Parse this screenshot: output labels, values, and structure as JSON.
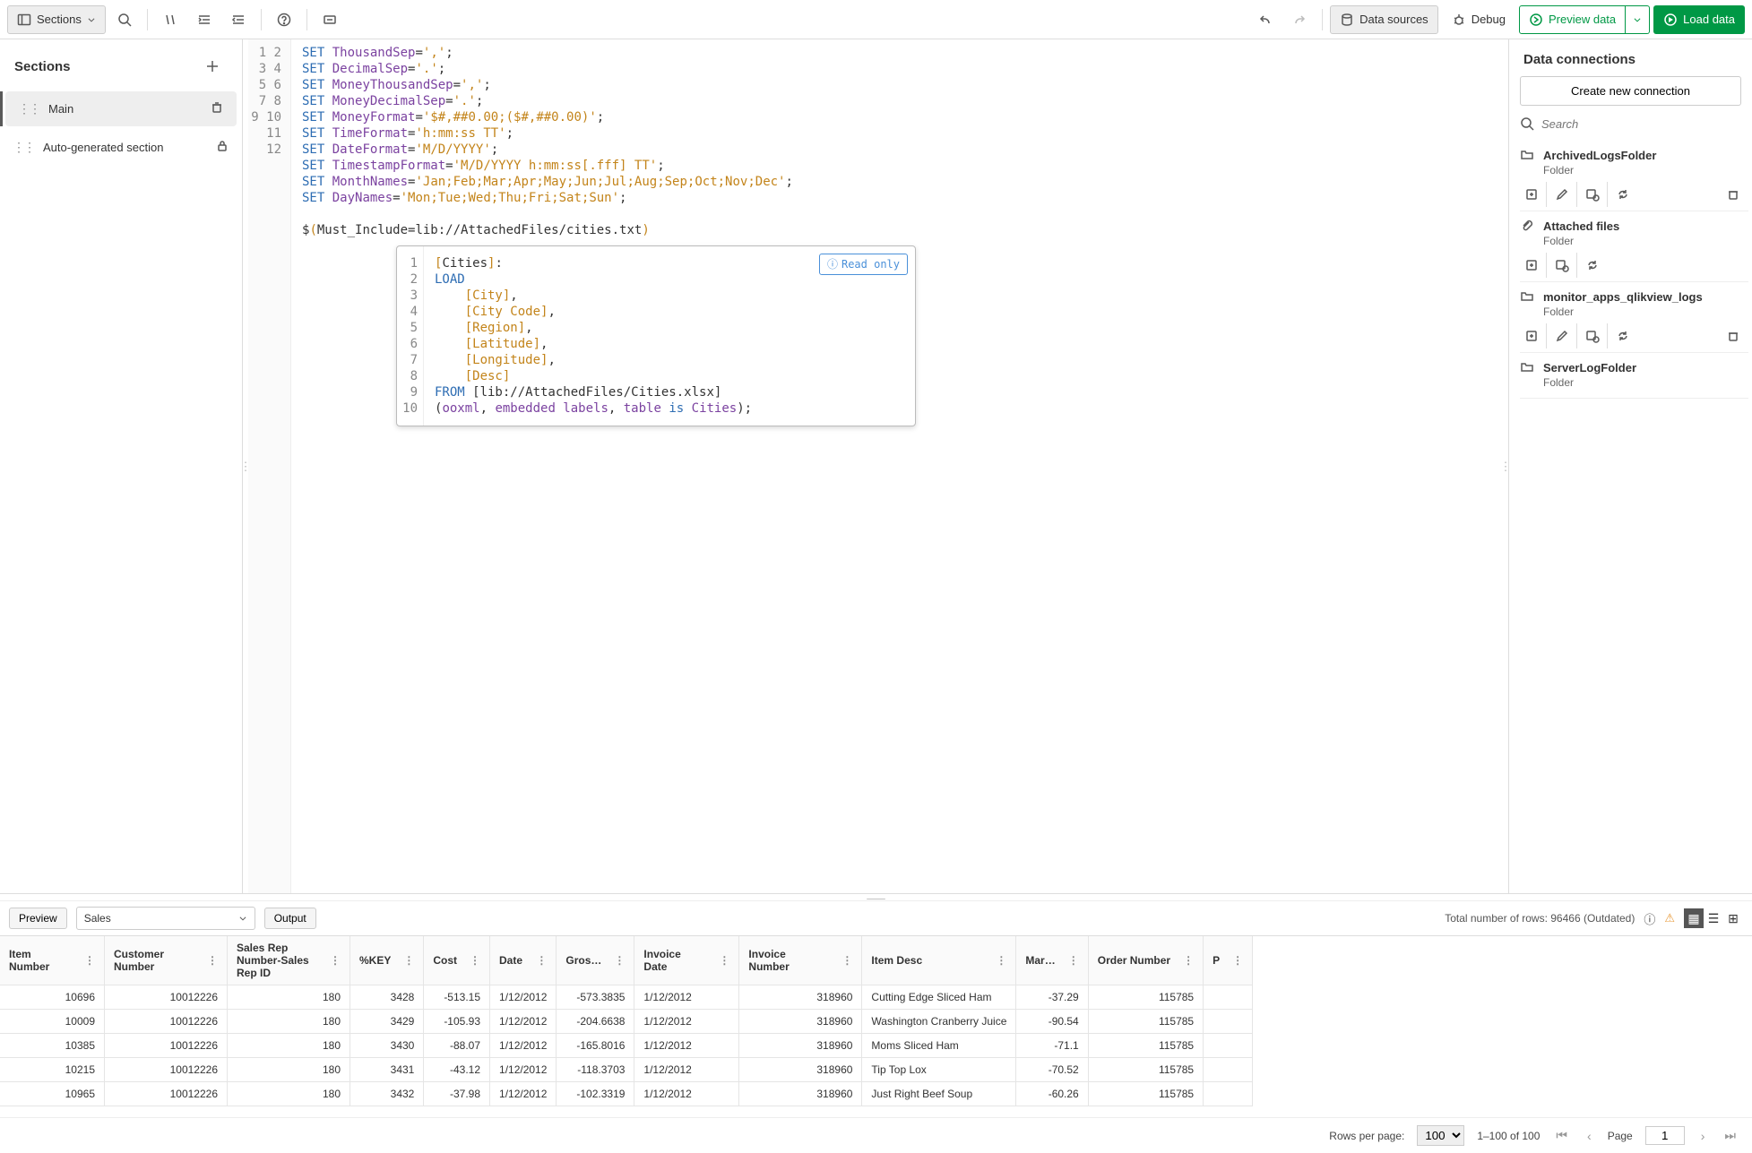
{
  "toolbar": {
    "sections_btn": "Sections",
    "data_sources": "Data sources",
    "debug": "Debug",
    "preview": "Preview data",
    "load": "Load data"
  },
  "sidebar": {
    "title": "Sections",
    "items": [
      {
        "label": "Main",
        "active": true,
        "icon": "trash"
      },
      {
        "label": "Auto-generated section",
        "active": false,
        "icon": "lock"
      }
    ]
  },
  "editor": {
    "lines": [
      {
        "n": 1,
        "tokens": [
          [
            "k",
            "SET"
          ],
          [
            "p",
            " "
          ],
          [
            "id",
            "ThousandSep"
          ],
          [
            "p",
            "="
          ],
          [
            "s",
            "','"
          ],
          [
            "p",
            ";"
          ]
        ]
      },
      {
        "n": 2,
        "tokens": [
          [
            "k",
            "SET"
          ],
          [
            "p",
            " "
          ],
          [
            "id",
            "DecimalSep"
          ],
          [
            "p",
            "="
          ],
          [
            "s",
            "'.'"
          ],
          [
            "p",
            ";"
          ]
        ]
      },
      {
        "n": 3,
        "tokens": [
          [
            "k",
            "SET"
          ],
          [
            "p",
            " "
          ],
          [
            "id",
            "MoneyThousandSep"
          ],
          [
            "p",
            "="
          ],
          [
            "s",
            "','"
          ],
          [
            "p",
            ";"
          ]
        ]
      },
      {
        "n": 4,
        "tokens": [
          [
            "k",
            "SET"
          ],
          [
            "p",
            " "
          ],
          [
            "id",
            "MoneyDecimalSep"
          ],
          [
            "p",
            "="
          ],
          [
            "s",
            "'.'"
          ],
          [
            "p",
            ";"
          ]
        ]
      },
      {
        "n": 5,
        "tokens": [
          [
            "k",
            "SET"
          ],
          [
            "p",
            " "
          ],
          [
            "id",
            "MoneyFormat"
          ],
          [
            "p",
            "="
          ],
          [
            "s",
            "'$#,##0.00;($#,##0.00)'"
          ],
          [
            "p",
            ";"
          ]
        ]
      },
      {
        "n": 6,
        "tokens": [
          [
            "k",
            "SET"
          ],
          [
            "p",
            " "
          ],
          [
            "id",
            "TimeFormat"
          ],
          [
            "p",
            "="
          ],
          [
            "s",
            "'h:mm:ss TT'"
          ],
          [
            "p",
            ";"
          ]
        ]
      },
      {
        "n": 7,
        "tokens": [
          [
            "k",
            "SET"
          ],
          [
            "p",
            " "
          ],
          [
            "id",
            "DateFormat"
          ],
          [
            "p",
            "="
          ],
          [
            "s",
            "'M/D/YYYY'"
          ],
          [
            "p",
            ";"
          ]
        ]
      },
      {
        "n": 8,
        "tokens": [
          [
            "k",
            "SET"
          ],
          [
            "p",
            " "
          ],
          [
            "id",
            "TimestampFormat"
          ],
          [
            "p",
            "="
          ],
          [
            "s",
            "'M/D/YYYY h:mm:ss[.fff] TT'"
          ],
          [
            "p",
            ";"
          ]
        ]
      },
      {
        "n": 9,
        "tokens": [
          [
            "k",
            "SET"
          ],
          [
            "p",
            " "
          ],
          [
            "id",
            "MonthNames"
          ],
          [
            "p",
            "="
          ],
          [
            "s",
            "'Jan;Feb;Mar;Apr;May;Jun;Jul;Aug;Sep;Oct;Nov;Dec'"
          ],
          [
            "p",
            ";"
          ]
        ]
      },
      {
        "n": 10,
        "tokens": [
          [
            "k",
            "SET"
          ],
          [
            "p",
            " "
          ],
          [
            "id",
            "DayNames"
          ],
          [
            "p",
            "="
          ],
          [
            "s",
            "'Mon;Tue;Wed;Thu;Fri;Sat;Sun'"
          ],
          [
            "p",
            ";"
          ]
        ]
      },
      {
        "n": 11,
        "tokens": []
      },
      {
        "n": 12,
        "tokens": [
          [
            "p",
            "$"
          ],
          [
            "s",
            "("
          ],
          [
            "p",
            "Must_Include=lib://AttachedFiles/cities.txt"
          ],
          [
            "s",
            ")"
          ]
        ]
      }
    ],
    "inline": {
      "readonly": "Read only",
      "lines": [
        {
          "n": 1,
          "tokens": [
            [
              "s",
              "["
            ],
            [
              "p",
              "Cities"
            ],
            [
              "s",
              "]"
            ],
            [
              "p",
              ":"
            ]
          ]
        },
        {
          "n": 2,
          "tokens": [
            [
              "k",
              "LOAD"
            ]
          ]
        },
        {
          "n": 3,
          "tokens": [
            [
              "p",
              "    "
            ],
            [
              "s",
              "[City]"
            ],
            [
              "p",
              ","
            ]
          ]
        },
        {
          "n": 4,
          "tokens": [
            [
              "p",
              "    "
            ],
            [
              "s",
              "[City Code]"
            ],
            [
              "p",
              ","
            ]
          ]
        },
        {
          "n": 5,
          "tokens": [
            [
              "p",
              "    "
            ],
            [
              "s",
              "[Region]"
            ],
            [
              "p",
              ","
            ]
          ]
        },
        {
          "n": 6,
          "tokens": [
            [
              "p",
              "    "
            ],
            [
              "s",
              "[Latitude]"
            ],
            [
              "p",
              ","
            ]
          ]
        },
        {
          "n": 7,
          "tokens": [
            [
              "p",
              "    "
            ],
            [
              "s",
              "[Longitude]"
            ],
            [
              "p",
              ","
            ]
          ]
        },
        {
          "n": 8,
          "tokens": [
            [
              "p",
              "    "
            ],
            [
              "s",
              "[Desc]"
            ]
          ]
        },
        {
          "n": 9,
          "tokens": [
            [
              "k",
              "FROM"
            ],
            [
              "p",
              " [lib://AttachedFiles/Cities.xlsx]"
            ]
          ]
        },
        {
          "n": 10,
          "tokens": [
            [
              "p",
              "("
            ],
            [
              "id",
              "ooxml"
            ],
            [
              "p",
              ", "
            ],
            [
              "id",
              "embedded labels"
            ],
            [
              "p",
              ", "
            ],
            [
              "id",
              "table"
            ],
            [
              "p",
              " "
            ],
            [
              "k",
              "is"
            ],
            [
              "p",
              " "
            ],
            [
              "id",
              "Cities"
            ],
            [
              "p",
              ");"
            ]
          ]
        }
      ]
    }
  },
  "right": {
    "title": "Data connections",
    "create": "Create new connection",
    "search_placeholder": "Search",
    "connections": [
      {
        "name": "ArchivedLogsFolder",
        "type": "Folder",
        "icon": "folder",
        "actions": [
          "insert",
          "edit",
          "select",
          "refresh",
          "trash"
        ]
      },
      {
        "name": "Attached files",
        "type": "Folder",
        "icon": "attach",
        "actions": [
          "insert",
          "select",
          "refresh"
        ]
      },
      {
        "name": "monitor_apps_qlikview_logs",
        "type": "Folder",
        "icon": "folder",
        "actions": [
          "insert",
          "edit",
          "select",
          "refresh",
          "trash"
        ]
      },
      {
        "name": "ServerLogFolder",
        "type": "Folder",
        "icon": "folder",
        "actions": []
      }
    ]
  },
  "panel": {
    "preview_btn": "Preview",
    "table_selected": "Sales",
    "output_btn": "Output",
    "total_rows": "Total number of rows: 96466 (Outdated)",
    "columns": [
      "Item Number",
      "Customer Number",
      "Sales Rep Number-Sales Rep ID",
      "%KEY",
      "Cost",
      "Date",
      "Gros…",
      "Invoice Date",
      "Invoice Number",
      "Item Desc",
      "Mar…",
      "Order Number",
      "P"
    ],
    "col_widths": [
      "wN",
      "",
      "",
      "wN",
      "wN",
      "wN",
      "wN",
      "wN",
      "",
      "wW",
      "wN",
      "",
      ""
    ],
    "rows": [
      [
        "10696",
        "10012226",
        "180",
        "3428",
        "-513.15",
        "1/12/2012",
        "-573.3835",
        "1/12/2012",
        "318960",
        "Cutting Edge Sliced Ham",
        "-37.29",
        "115785",
        ""
      ],
      [
        "10009",
        "10012226",
        "180",
        "3429",
        "-105.93",
        "1/12/2012",
        "-204.6638",
        "1/12/2012",
        "318960",
        "Washington Cranberry Juice",
        "-90.54",
        "115785",
        ""
      ],
      [
        "10385",
        "10012226",
        "180",
        "3430",
        "-88.07",
        "1/12/2012",
        "-165.8016",
        "1/12/2012",
        "318960",
        "Moms Sliced Ham",
        "-71.1",
        "115785",
        ""
      ],
      [
        "10215",
        "10012226",
        "180",
        "3431",
        "-43.12",
        "1/12/2012",
        "-118.3703",
        "1/12/2012",
        "318960",
        "Tip Top Lox",
        "-70.52",
        "115785",
        ""
      ],
      [
        "10965",
        "10012226",
        "180",
        "3432",
        "-37.98",
        "1/12/2012",
        "-102.3319",
        "1/12/2012",
        "318960",
        "Just Right Beef Soup",
        "-60.26",
        "115785",
        ""
      ]
    ],
    "numeric_cols": [
      0,
      1,
      2,
      3,
      4,
      6,
      8,
      10,
      11
    ],
    "rows_per_page_label": "Rows per page:",
    "rows_per_page": "100",
    "range": "1–100 of 100",
    "page_label": "Page",
    "page": "1"
  }
}
